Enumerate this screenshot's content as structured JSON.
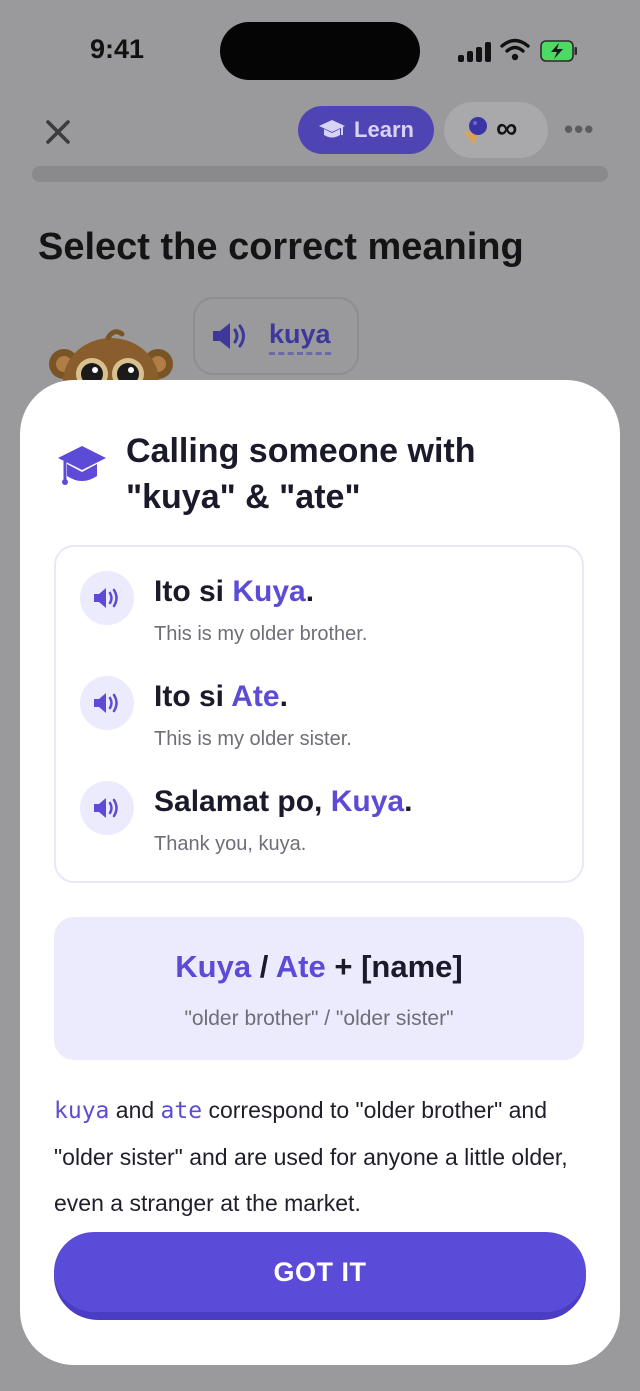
{
  "status_bar": {
    "time": "9:41"
  },
  "header": {
    "learn_label": "Learn",
    "energy_value": "∞",
    "more_label": "•••"
  },
  "lesson": {
    "prompt": "Select the correct meaning",
    "audio_word": "kuya"
  },
  "tip_card": {
    "title": "Calling someone with \"kuya\" & \"ate\"",
    "examples": [
      {
        "before": "Ito si ",
        "highlight": "Kuya",
        "after": ".",
        "translation": "This is my older brother."
      },
      {
        "before": "Ito si ",
        "highlight": "Ate",
        "after": ".",
        "translation": "This is my older sister."
      },
      {
        "before": "Salamat po, ",
        "highlight": "Kuya",
        "after": ".",
        "translation": "Thank you, kuya."
      }
    ],
    "formula": {
      "term1": "Kuya",
      "sep": " / ",
      "term2": "Ate",
      "rest": " + [name]",
      "gloss": "\"older brother\" / \"older sister\""
    },
    "explanation": {
      "term1": "kuya",
      "text1": " and ",
      "term2": "ate",
      "text2": " correspond to \"older brother\" and \"older sister\" and are used for anyone a little older, even a stranger at the market."
    },
    "button_label": "GOT IT"
  },
  "colors": {
    "accent": "#5b4bd9",
    "highlight": "#5b4bd6",
    "tint": "#ecebfd",
    "overlay": "#9a9a9c"
  },
  "icons": {
    "close": "close-icon",
    "learn": "graduation-cap-icon",
    "energy": "ice-cream-icon",
    "speaker": "speaker-icon",
    "mascot": "monkey-mascot"
  }
}
